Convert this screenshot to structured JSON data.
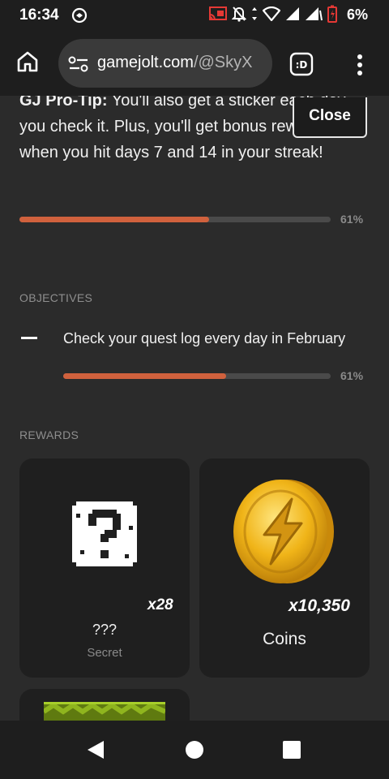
{
  "status_bar": {
    "time": "16:34",
    "battery_percent": "6%",
    "icons": [
      "cast-app-icon",
      "screen-cast-icon",
      "notifications-off-icon",
      "data-arrows-icon",
      "wifi-icon",
      "signal-icon",
      "signal-2-icon",
      "battery-low-icon"
    ]
  },
  "browser": {
    "url_domain": "gamejolt.com",
    "url_path": "/@SkyX",
    "extension_label": ":D",
    "icons": [
      "home-icon",
      "tune-icon",
      "extension-icon",
      "more-vert-icon"
    ]
  },
  "quest": {
    "protip_label": "GJ Pro-Tip:",
    "protip_text": " You'll also get a sticker each day you check it. Plus, you'll get bonus rewards when you hit days 7 and 14 in your streak!",
    "close_label": "Close",
    "progress_percent": "61%",
    "progress_fraction": 0.61
  },
  "objectives": {
    "heading": "OBJECTIVES",
    "items": [
      {
        "text": "Check your quest log every day in February",
        "progress_percent": "61%",
        "progress_fraction": 0.61
      }
    ]
  },
  "rewards": {
    "heading": "REWARDS",
    "items": [
      {
        "name": "???",
        "subtitle": "Secret",
        "quantity": "x28",
        "icon": "mystery-sticker-icon"
      },
      {
        "name": "Coins",
        "quantity": "x10,350",
        "icon": "gold-coin-icon"
      },
      {
        "name": "",
        "icon": "green-block-icon"
      }
    ]
  },
  "colors": {
    "background": "#2a2a2a",
    "card": "#1f1f1f",
    "progress_fill": "#d0613d",
    "progress_track": "#4a4a4a",
    "battery_low": "#e53935"
  }
}
